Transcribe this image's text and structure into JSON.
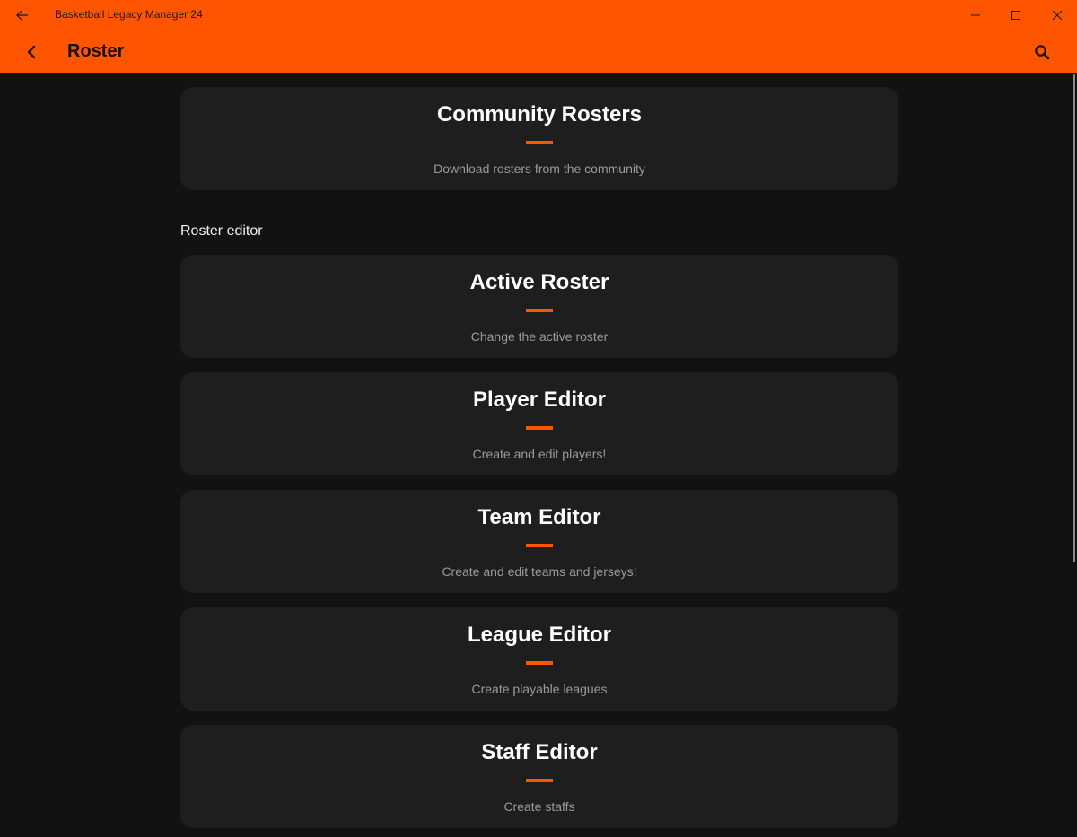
{
  "window": {
    "title": "Basketball Legacy Manager 24",
    "accent_color": "#ff5500"
  },
  "appbar": {
    "title": "Roster"
  },
  "community_card": {
    "title": "Community Rosters",
    "description": "Download rosters from the community"
  },
  "section": {
    "label": "Roster editor"
  },
  "editor_cards": [
    {
      "title": "Active Roster",
      "description": "Change the active roster"
    },
    {
      "title": "Player Editor",
      "description": "Create and edit players!"
    },
    {
      "title": "Team Editor",
      "description": "Create and edit teams and jerseys!"
    },
    {
      "title": "League Editor",
      "description": "Create playable leagues"
    },
    {
      "title": "Staff Editor",
      "description": "Create staffs"
    }
  ],
  "icons": {
    "titlebar_back": "arrow-left-icon",
    "minimize": "minimize-icon",
    "maximize": "maximize-icon",
    "close": "close-icon",
    "appbar_back": "chevron-left-icon",
    "search": "search-icon"
  }
}
